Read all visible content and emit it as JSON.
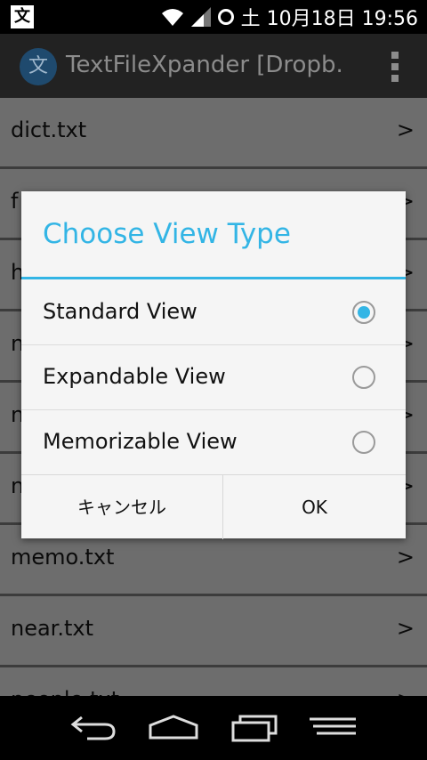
{
  "status_bar": {
    "left_icon": "文",
    "time": "土 10月18日 19:56"
  },
  "action_bar": {
    "app_icon_glyph": "文",
    "title": "TextFileXpander [Dropb."
  },
  "file_list": [
    {
      "name": "dict.txt",
      "chevron": ">"
    },
    {
      "name": "f",
      "chevron": ">"
    },
    {
      "name": "h",
      "chevron": ">"
    },
    {
      "name": "n",
      "chevron": ">"
    },
    {
      "name": "n",
      "chevron": ">"
    },
    {
      "name": "n",
      "chevron": ">"
    },
    {
      "name": "memo.txt",
      "chevron": ">"
    },
    {
      "name": "near.txt",
      "chevron": ">"
    },
    {
      "name": "people.txt",
      "chevron": ">"
    }
  ],
  "dialog": {
    "title": "Choose View Type",
    "options": [
      {
        "label": "Standard View",
        "selected": true
      },
      {
        "label": "Expandable View",
        "selected": false
      },
      {
        "label": "Memorizable View",
        "selected": false
      }
    ],
    "cancel_label": "キャンセル",
    "ok_label": "OK"
  },
  "colors": {
    "accent": "#33b5e5",
    "list_bg": "#6d6d6d",
    "dialog_bg": "#f5f5f5"
  }
}
